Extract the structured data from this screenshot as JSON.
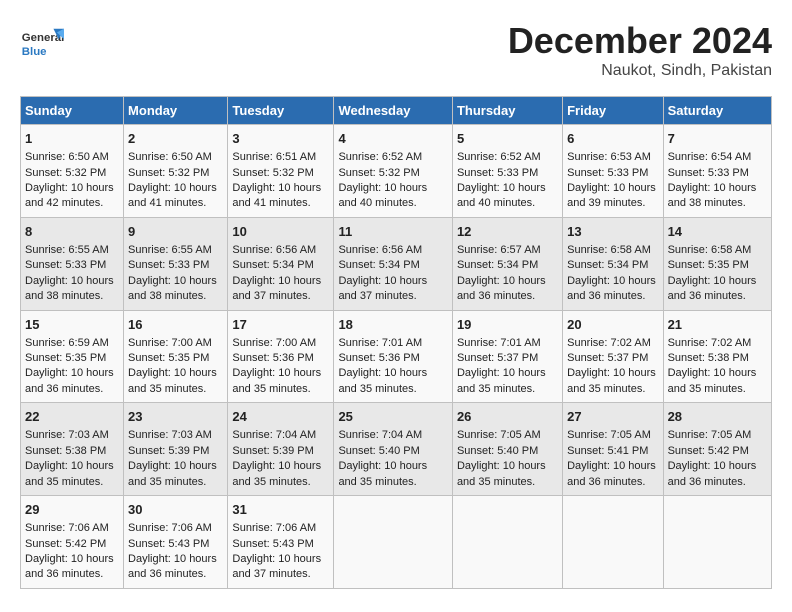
{
  "header": {
    "logo": {
      "general": "General",
      "blue": "Blue"
    },
    "title": "December 2024",
    "subtitle": "Naukot, Sindh, Pakistan"
  },
  "calendar": {
    "days_of_week": [
      "Sunday",
      "Monday",
      "Tuesday",
      "Wednesday",
      "Thursday",
      "Friday",
      "Saturday"
    ],
    "weeks": [
      [
        {
          "day": "1",
          "sunrise": "Sunrise: 6:50 AM",
          "sunset": "Sunset: 5:32 PM",
          "daylight": "Daylight: 10 hours and 42 minutes."
        },
        {
          "day": "2",
          "sunrise": "Sunrise: 6:50 AM",
          "sunset": "Sunset: 5:32 PM",
          "daylight": "Daylight: 10 hours and 41 minutes."
        },
        {
          "day": "3",
          "sunrise": "Sunrise: 6:51 AM",
          "sunset": "Sunset: 5:32 PM",
          "daylight": "Daylight: 10 hours and 41 minutes."
        },
        {
          "day": "4",
          "sunrise": "Sunrise: 6:52 AM",
          "sunset": "Sunset: 5:32 PM",
          "daylight": "Daylight: 10 hours and 40 minutes."
        },
        {
          "day": "5",
          "sunrise": "Sunrise: 6:52 AM",
          "sunset": "Sunset: 5:33 PM",
          "daylight": "Daylight: 10 hours and 40 minutes."
        },
        {
          "day": "6",
          "sunrise": "Sunrise: 6:53 AM",
          "sunset": "Sunset: 5:33 PM",
          "daylight": "Daylight: 10 hours and 39 minutes."
        },
        {
          "day": "7",
          "sunrise": "Sunrise: 6:54 AM",
          "sunset": "Sunset: 5:33 PM",
          "daylight": "Daylight: 10 hours and 38 minutes."
        }
      ],
      [
        {
          "day": "8",
          "sunrise": "Sunrise: 6:55 AM",
          "sunset": "Sunset: 5:33 PM",
          "daylight": "Daylight: 10 hours and 38 minutes."
        },
        {
          "day": "9",
          "sunrise": "Sunrise: 6:55 AM",
          "sunset": "Sunset: 5:33 PM",
          "daylight": "Daylight: 10 hours and 38 minutes."
        },
        {
          "day": "10",
          "sunrise": "Sunrise: 6:56 AM",
          "sunset": "Sunset: 5:34 PM",
          "daylight": "Daylight: 10 hours and 37 minutes."
        },
        {
          "day": "11",
          "sunrise": "Sunrise: 6:56 AM",
          "sunset": "Sunset: 5:34 PM",
          "daylight": "Daylight: 10 hours and 37 minutes."
        },
        {
          "day": "12",
          "sunrise": "Sunrise: 6:57 AM",
          "sunset": "Sunset: 5:34 PM",
          "daylight": "Daylight: 10 hours and 36 minutes."
        },
        {
          "day": "13",
          "sunrise": "Sunrise: 6:58 AM",
          "sunset": "Sunset: 5:34 PM",
          "daylight": "Daylight: 10 hours and 36 minutes."
        },
        {
          "day": "14",
          "sunrise": "Sunrise: 6:58 AM",
          "sunset": "Sunset: 5:35 PM",
          "daylight": "Daylight: 10 hours and 36 minutes."
        }
      ],
      [
        {
          "day": "15",
          "sunrise": "Sunrise: 6:59 AM",
          "sunset": "Sunset: 5:35 PM",
          "daylight": "Daylight: 10 hours and 36 minutes."
        },
        {
          "day": "16",
          "sunrise": "Sunrise: 7:00 AM",
          "sunset": "Sunset: 5:35 PM",
          "daylight": "Daylight: 10 hours and 35 minutes."
        },
        {
          "day": "17",
          "sunrise": "Sunrise: 7:00 AM",
          "sunset": "Sunset: 5:36 PM",
          "daylight": "Daylight: 10 hours and 35 minutes."
        },
        {
          "day": "18",
          "sunrise": "Sunrise: 7:01 AM",
          "sunset": "Sunset: 5:36 PM",
          "daylight": "Daylight: 10 hours and 35 minutes."
        },
        {
          "day": "19",
          "sunrise": "Sunrise: 7:01 AM",
          "sunset": "Sunset: 5:37 PM",
          "daylight": "Daylight: 10 hours and 35 minutes."
        },
        {
          "day": "20",
          "sunrise": "Sunrise: 7:02 AM",
          "sunset": "Sunset: 5:37 PM",
          "daylight": "Daylight: 10 hours and 35 minutes."
        },
        {
          "day": "21",
          "sunrise": "Sunrise: 7:02 AM",
          "sunset": "Sunset: 5:38 PM",
          "daylight": "Daylight: 10 hours and 35 minutes."
        }
      ],
      [
        {
          "day": "22",
          "sunrise": "Sunrise: 7:03 AM",
          "sunset": "Sunset: 5:38 PM",
          "daylight": "Daylight: 10 hours and 35 minutes."
        },
        {
          "day": "23",
          "sunrise": "Sunrise: 7:03 AM",
          "sunset": "Sunset: 5:39 PM",
          "daylight": "Daylight: 10 hours and 35 minutes."
        },
        {
          "day": "24",
          "sunrise": "Sunrise: 7:04 AM",
          "sunset": "Sunset: 5:39 PM",
          "daylight": "Daylight: 10 hours and 35 minutes."
        },
        {
          "day": "25",
          "sunrise": "Sunrise: 7:04 AM",
          "sunset": "Sunset: 5:40 PM",
          "daylight": "Daylight: 10 hours and 35 minutes."
        },
        {
          "day": "26",
          "sunrise": "Sunrise: 7:05 AM",
          "sunset": "Sunset: 5:40 PM",
          "daylight": "Daylight: 10 hours and 35 minutes."
        },
        {
          "day": "27",
          "sunrise": "Sunrise: 7:05 AM",
          "sunset": "Sunset: 5:41 PM",
          "daylight": "Daylight: 10 hours and 36 minutes."
        },
        {
          "day": "28",
          "sunrise": "Sunrise: 7:05 AM",
          "sunset": "Sunset: 5:42 PM",
          "daylight": "Daylight: 10 hours and 36 minutes."
        }
      ],
      [
        {
          "day": "29",
          "sunrise": "Sunrise: 7:06 AM",
          "sunset": "Sunset: 5:42 PM",
          "daylight": "Daylight: 10 hours and 36 minutes."
        },
        {
          "day": "30",
          "sunrise": "Sunrise: 7:06 AM",
          "sunset": "Sunset: 5:43 PM",
          "daylight": "Daylight: 10 hours and 36 minutes."
        },
        {
          "day": "31",
          "sunrise": "Sunrise: 7:06 AM",
          "sunset": "Sunset: 5:43 PM",
          "daylight": "Daylight: 10 hours and 37 minutes."
        },
        {
          "day": "",
          "sunrise": "",
          "sunset": "",
          "daylight": ""
        },
        {
          "day": "",
          "sunrise": "",
          "sunset": "",
          "daylight": ""
        },
        {
          "day": "",
          "sunrise": "",
          "sunset": "",
          "daylight": ""
        },
        {
          "day": "",
          "sunrise": "",
          "sunset": "",
          "daylight": ""
        }
      ]
    ]
  }
}
